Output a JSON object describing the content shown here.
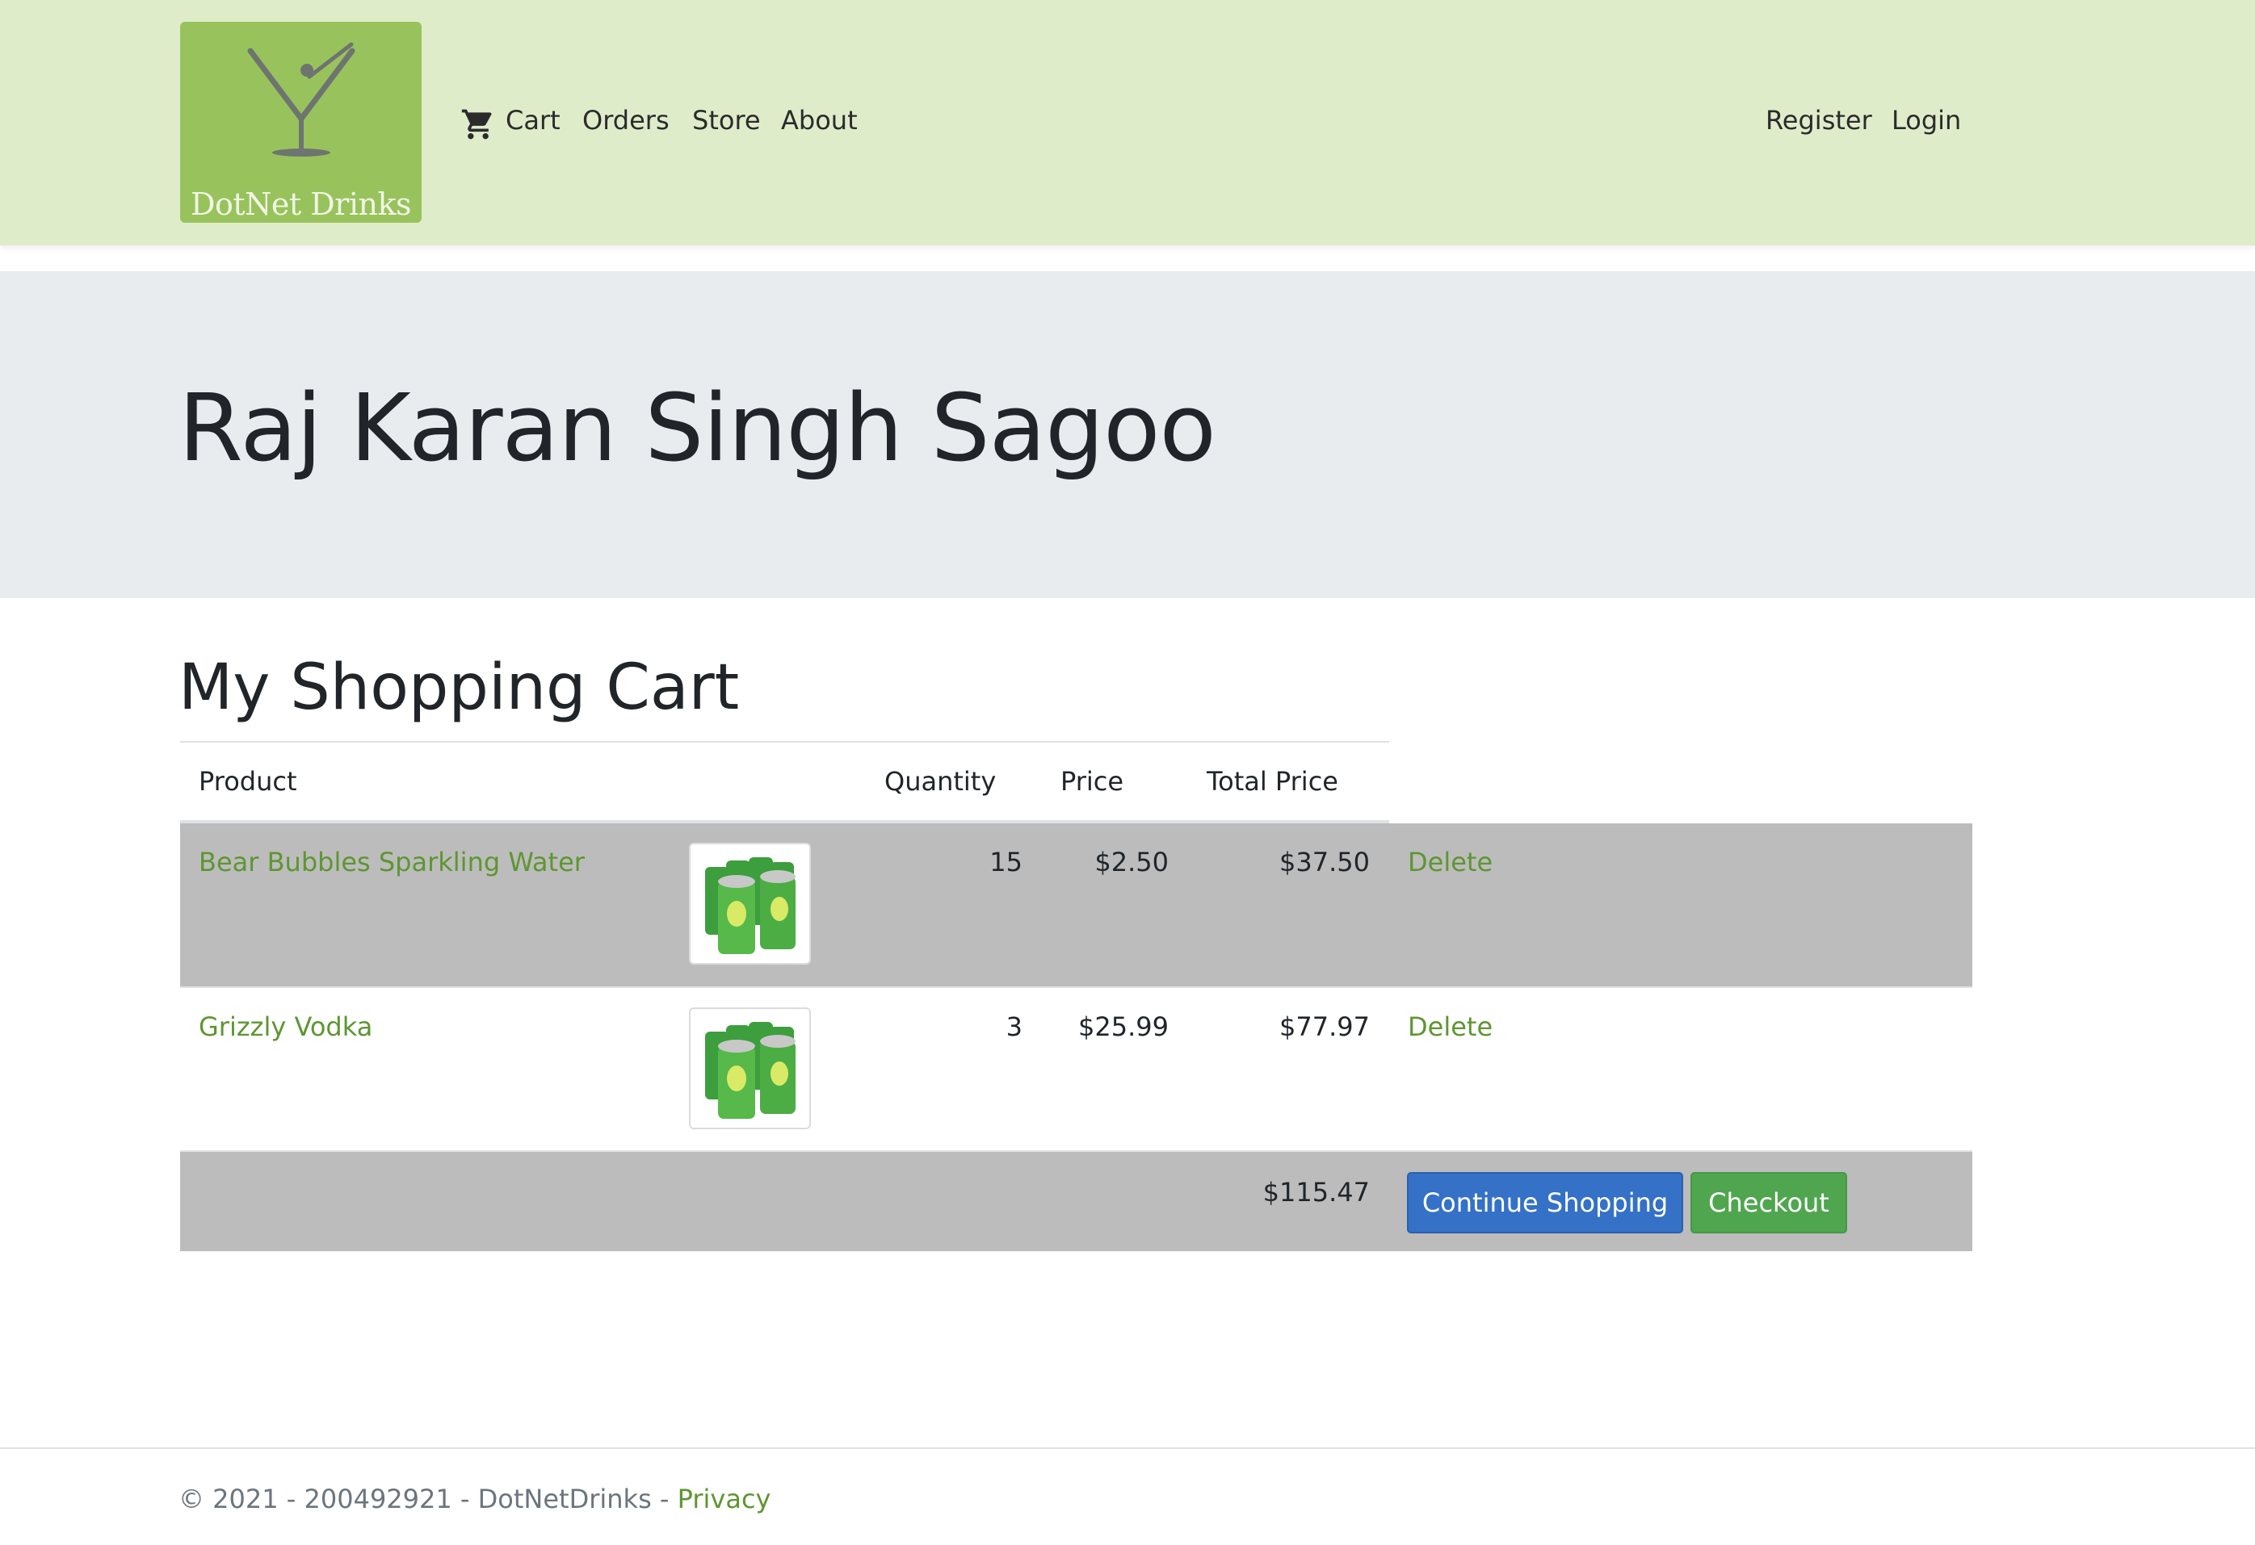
{
  "brand": {
    "name": "DotNet Drinks"
  },
  "nav": {
    "left": [
      {
        "label": "Cart",
        "icon": "cart-icon"
      },
      {
        "label": "Orders"
      },
      {
        "label": "Store"
      },
      {
        "label": "About"
      }
    ],
    "right": [
      {
        "label": "Register"
      },
      {
        "label": "Login"
      }
    ]
  },
  "jumbotron": {
    "title": "Raj Karan Singh Sagoo"
  },
  "cart": {
    "title": "My Shopping Cart",
    "columns": [
      "Product",
      "Quantity",
      "Price",
      "Total Price"
    ],
    "rows": [
      {
        "product": "Bear Bubbles Sparkling Water",
        "image_icon": "soda-cans-icon",
        "quantity": "15",
        "price": "$2.50",
        "total": "$37.50",
        "action": "Delete"
      },
      {
        "product": "Grizzly Vodka",
        "image_icon": "soda-cans-icon",
        "quantity": "3",
        "price": "$25.99",
        "total": "$77.97",
        "action": "Delete"
      }
    ],
    "grand_total": "$115.47",
    "continue_label": "Continue Shopping",
    "checkout_label": "Checkout"
  },
  "footer": {
    "text": "© 2021 - 200492921 - DotNetDrinks - ",
    "privacy_label": "Privacy"
  },
  "colors": {
    "header_bg": "#dfecca",
    "logo_bg": "#98c35c",
    "jumbotron_bg": "#e9ecef",
    "row_highlight": "#bcbcbc",
    "link": "#5e9632",
    "primary_button": "#3471c7",
    "success_button": "#4fa64f"
  }
}
